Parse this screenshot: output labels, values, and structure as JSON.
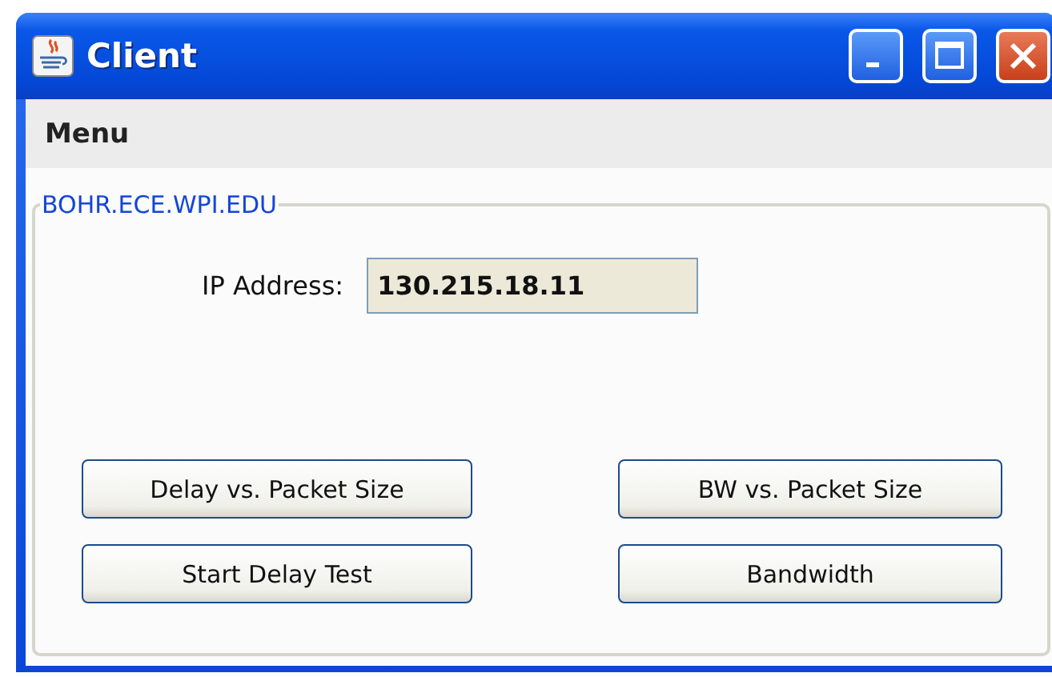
{
  "window": {
    "title": "Client"
  },
  "menu_bar": {
    "items": [
      "Menu"
    ]
  },
  "group": {
    "title": "BOHR.ECE.WPI.EDU",
    "ip_field": {
      "label": "IP Address:",
      "value": "130.215.18.11"
    },
    "buttons": [
      "Delay vs. Packet Size",
      "BW vs. Packet Size",
      "Start Delay Test",
      "Bandwidth"
    ]
  }
}
